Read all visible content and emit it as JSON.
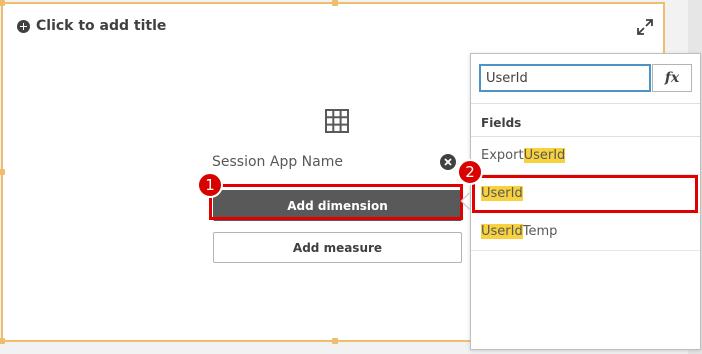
{
  "panel": {
    "title_placeholder": "Click to add title",
    "field_name": "Session App Name",
    "add_dimension_label": "Add dimension",
    "add_measure_label": "Add measure"
  },
  "annotations": {
    "badge_1": "1",
    "badge_2": "2"
  },
  "popover": {
    "search_value": "UserId",
    "fx_label": "fx",
    "fields_header": "Fields",
    "fields": [
      {
        "prefix": "Export ",
        "match": "UserId",
        "suffix": ""
      },
      {
        "prefix": "",
        "match": "UserId",
        "suffix": ""
      },
      {
        "prefix": "",
        "match": "UserId",
        "suffix": "Temp"
      }
    ]
  },
  "colors": {
    "selection_border": "#f0bd6c",
    "highlight": "#f7d23e",
    "annotation_red": "#e00000",
    "primary_button": "#595959"
  }
}
